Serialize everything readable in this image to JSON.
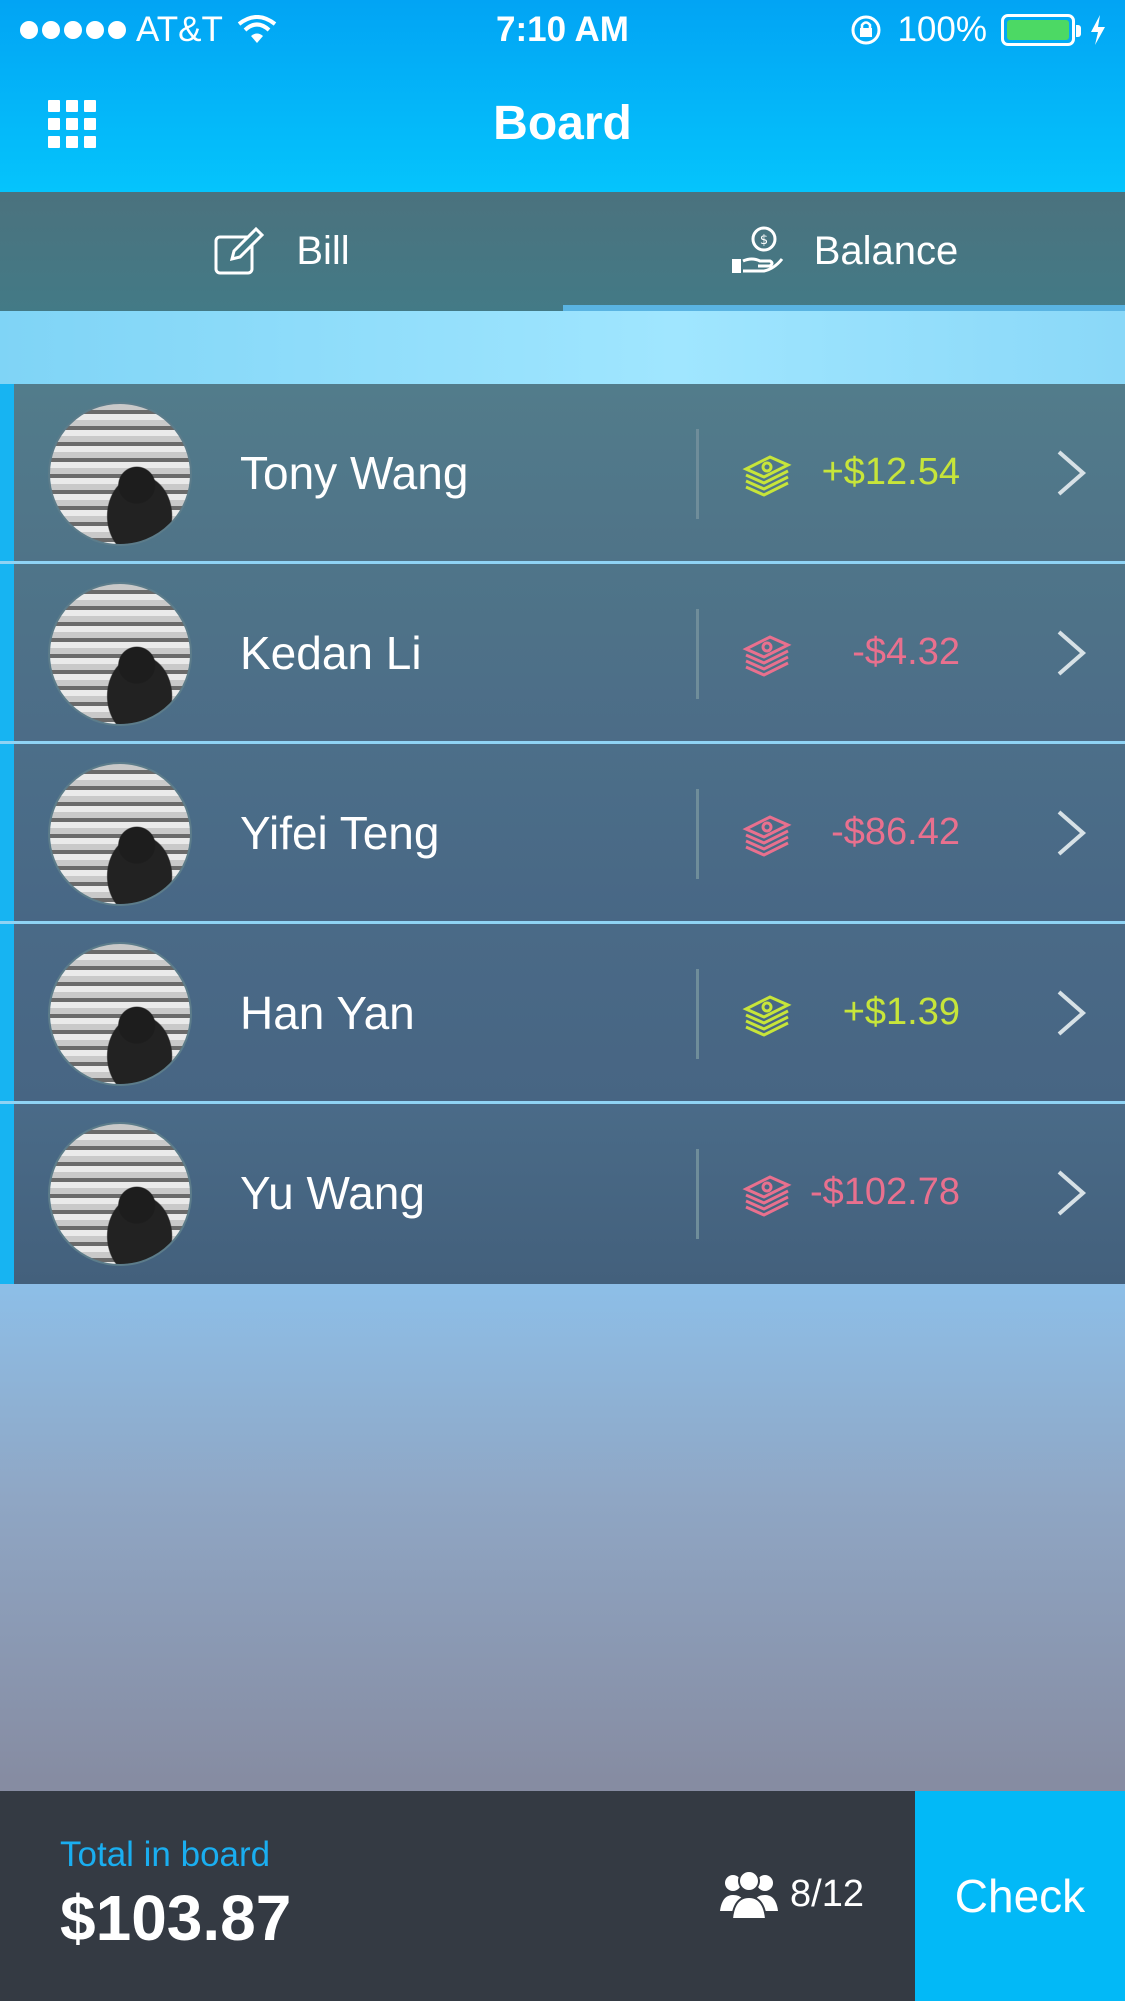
{
  "status_bar": {
    "carrier": "AT&T",
    "time": "7:10 AM",
    "battery": "100%"
  },
  "header": {
    "title": "Board"
  },
  "tabs": [
    {
      "label": "Bill",
      "icon": "edit-icon"
    },
    {
      "label": "Balance",
      "icon": "hand-coin-icon",
      "selected": true
    }
  ],
  "members": [
    {
      "name": "Tony Wang",
      "amount": "+$12.54",
      "status": "positive"
    },
    {
      "name": "Kedan Li",
      "amount": "-$4.32",
      "status": "negative"
    },
    {
      "name": "Yifei Teng",
      "amount": "-$86.42",
      "status": "negative"
    },
    {
      "name": "Han Yan",
      "amount": "+$1.39",
      "status": "positive"
    },
    {
      "name": "Yu Wang",
      "amount": "-$102.78",
      "status": "negative"
    }
  ],
  "footer": {
    "total_label": "Total in board",
    "total_value": "$103.87",
    "members_count": "8/12",
    "check_label": "Check"
  },
  "colors": {
    "header": "#02a4f4",
    "positive": "#c7e53a",
    "negative": "#e9708e",
    "accent": "#02b9f7",
    "footer": "#343a43"
  }
}
